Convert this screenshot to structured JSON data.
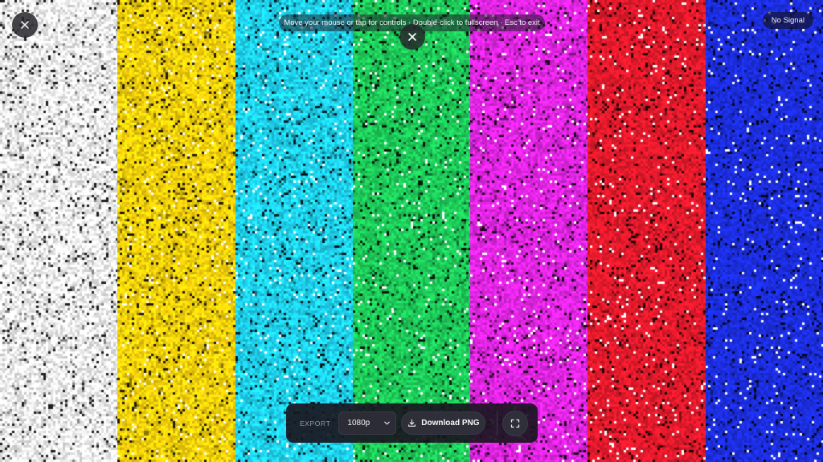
{
  "bars": [
    {
      "name": "white",
      "color": "#f0f0f0"
    },
    {
      "name": "yellow",
      "color": "#f6d20b"
    },
    {
      "name": "cyan",
      "color": "#1fd3ef"
    },
    {
      "name": "green",
      "color": "#1ecc5a"
    },
    {
      "name": "magenta",
      "color": "#e326e6"
    },
    {
      "name": "red",
      "color": "#e51a2c"
    },
    {
      "name": "blue",
      "color": "#1c2ee0"
    }
  ],
  "hint_text": "Move your mouse or tap for controls · Double-click to fullscreen · Esc to exit",
  "status": "No Signal",
  "toolbar": {
    "export_label": "EXPORT",
    "resolution": "1080p",
    "download_label": "Download PNG"
  },
  "icons": {
    "close": "close-icon",
    "chevron": "chevron-down-icon",
    "download": "download-icon",
    "fullscreen": "fullscreen-icon"
  }
}
